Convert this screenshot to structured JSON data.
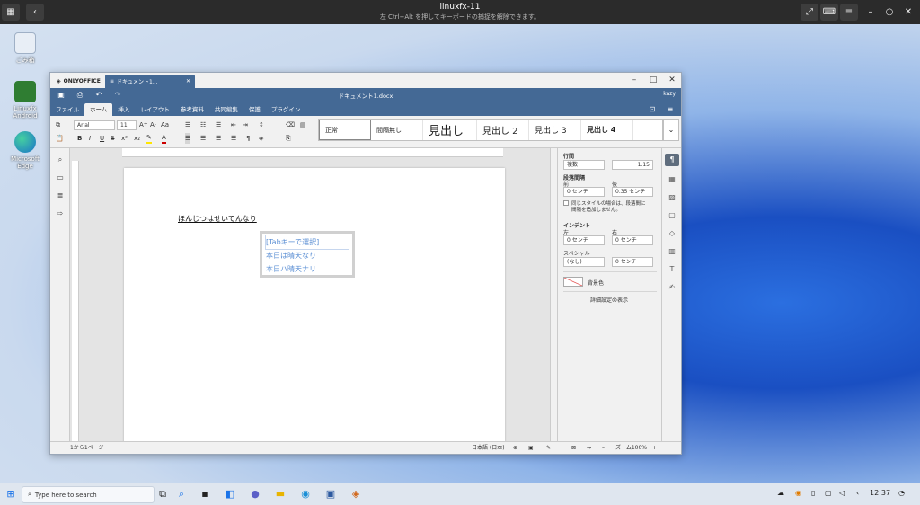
{
  "topbar": {
    "title": "linuxfx-11",
    "subtitle": "左 Ctrl+Alt を押してキーボードの捕捉を解除できます。"
  },
  "desktop_icons": [
    {
      "label": "ごみ箱",
      "icon": "recycle-bin-icon"
    },
    {
      "label": "Linuxfx Android",
      "icon": "android-icon"
    },
    {
      "label": "Microsoft Edge",
      "icon": "edge-icon"
    }
  ],
  "window": {
    "app_tab": "ONLYOFFICE",
    "doc_tab": "ドキュメント1...",
    "doc_title": "ドキュメント1.docx",
    "user": "kazy",
    "menu": [
      "ファイル",
      "ホーム",
      "挿入",
      "レイアウト",
      "参考資料",
      "共同編集",
      "保護",
      "プラグイン"
    ],
    "active_menu": "ホーム",
    "font_name": "Arial",
    "font_size": "11",
    "styles": [
      "正常",
      "間隔無し",
      "見出し",
      "見出し 2",
      "見出し 3",
      "見出し 4"
    ]
  },
  "document": {
    "body_text": "ほんじつはせいてんなり",
    "ime_candidates": [
      "[Tabキーで選択]",
      "本日は晴天なり",
      "本日ハ晴天ナリ"
    ]
  },
  "paragraph_panel": {
    "line_spacing_label": "行間",
    "line_spacing_mode": "複数",
    "line_spacing_value": "1.15",
    "para_spacing_label": "段落間隔",
    "before_label": "前",
    "after_label": "後",
    "before_value": "0 センチ",
    "after_value": "0.35 センチ",
    "same_style_text_1": "同じスタイルの場合は、段落間に",
    "same_style_text_2": "間隔を追加しません。",
    "indent_label": "インデント",
    "left_label": "左",
    "right_label": "右",
    "left_value": "0 センチ",
    "right_value": "0 センチ",
    "special_label": "スペシャル",
    "special_value": "(なし)",
    "special_amount": "0 センチ",
    "bg_color_label": "背景色",
    "advanced_link": "詳細設定の表示"
  },
  "statusbar": {
    "page_info": "1から1ページ",
    "language": "日本語 (日本)",
    "zoom": "ズーム100%"
  },
  "taskbar": {
    "search_placeholder": "Type here to search",
    "time": "12:37"
  },
  "colors": {
    "header": "#446995",
    "ime_text": "#5b8fd4"
  }
}
